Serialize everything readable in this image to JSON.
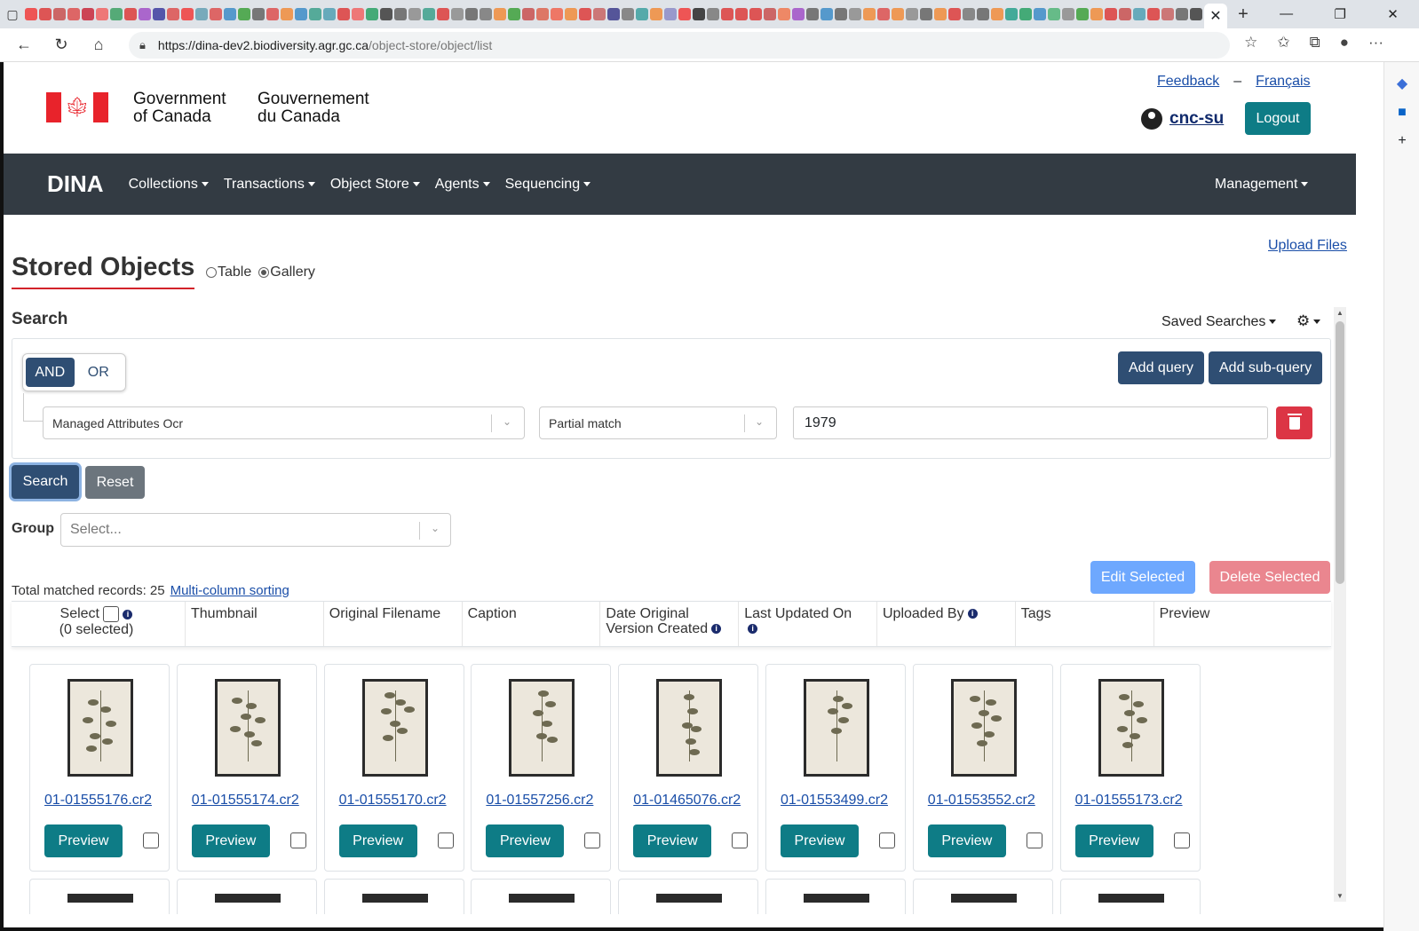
{
  "browser": {
    "url_host": "https://dina-dev2.biodiversity.agr.gc.ca",
    "url_path": "/object-store/object/list",
    "tab_close": "✕",
    "favicon_colors": [
      "#e55",
      "#d55",
      "#c66",
      "#d66",
      "#c45",
      "#e77",
      "#5a7",
      "#d55",
      "#a6c",
      "#55a",
      "#d66",
      "#e55",
      "#7ab",
      "#d66",
      "#59c",
      "#5a5",
      "#777",
      "#d66",
      "#e95",
      "#59c",
      "#5a9",
      "#6ab",
      "#d55",
      "#e77",
      "#4a7",
      "#555",
      "#777",
      "#999",
      "#5a9",
      "#d55",
      "#999",
      "#777",
      "#888",
      "#e95",
      "#5a5",
      "#c66",
      "#d76",
      "#e76",
      "#e95",
      "#d55",
      "#c77",
      "#559",
      "#888",
      "#5aa",
      "#e95",
      "#99c",
      "#e55",
      "#444",
      "#888",
      "#d55",
      "#d55",
      "#d55",
      "#c66",
      "#e86",
      "#a6c",
      "#777",
      "#59c",
      "#777",
      "#999",
      "#e95",
      "#d66",
      "#e95",
      "#999",
      "#777",
      "#e95",
      "#d55",
      "#888",
      "#777",
      "#e95",
      "#4a9",
      "#4a7",
      "#59c",
      "#6b8",
      "#999",
      "#5a5",
      "#e95",
      "#d55",
      "#c66",
      "#6ab",
      "#d55",
      "#c77",
      "#777",
      "#555",
      "#d66",
      "#e86",
      "#999",
      "#999",
      "#d55",
      "#d55",
      "#59c",
      "#d55",
      "#e55",
      "#555",
      "#d55",
      "#d66",
      "#999",
      "#26a",
      "#777",
      "#999",
      "#5a5"
    ]
  },
  "header": {
    "gov_en_line1": "Government",
    "gov_en_line2": "of Canada",
    "gov_fr_line1": "Gouvernement",
    "gov_fr_line2": "du Canada",
    "feedback": "Feedback",
    "separator": "–",
    "language": "Français",
    "username": "cnc-su",
    "logout": "Logout"
  },
  "nav": {
    "brand": "DINA",
    "items": [
      "Collections",
      "Transactions",
      "Object Store",
      "Agents",
      "Sequencing"
    ],
    "right": "Management"
  },
  "page": {
    "upload_files": "Upload Files",
    "title": "Stored Objects",
    "view_table": "Table",
    "view_gallery": "Gallery",
    "selected_view": "Gallery"
  },
  "search": {
    "heading": "Search",
    "saved_searches": "Saved Searches",
    "and_label": "AND",
    "or_label": "OR",
    "add_query": "Add query",
    "add_subquery": "Add sub-query",
    "field": "Managed Attributes Ocr",
    "match_type": "Partial match",
    "value": "1979",
    "search_button": "Search",
    "reset_button": "Reset",
    "group_label": "Group",
    "group_placeholder": "Select..."
  },
  "results": {
    "total_label": "Total matched records: 25",
    "multi_sort": "Multi-column sorting",
    "edit_selected": "Edit Selected",
    "delete_selected": "Delete Selected",
    "columns": {
      "select": "Select",
      "selected_count": "(0 selected)",
      "thumbnail": "Thumbnail",
      "original_filename": "Original Filename",
      "caption": "Caption",
      "date_original": "Date Original Version Created",
      "last_updated": "Last Updated On",
      "uploaded_by": "Uploaded By",
      "tags": "Tags",
      "preview": "Preview"
    },
    "cards": [
      {
        "filename": "01-01555176.cr2",
        "preview": "Preview"
      },
      {
        "filename": "01-01555174.cr2",
        "preview": "Preview"
      },
      {
        "filename": "01-01555170.cr2",
        "preview": "Preview"
      },
      {
        "filename": "01-01557256.cr2",
        "preview": "Preview"
      },
      {
        "filename": "01-01465076.cr2",
        "preview": "Preview"
      },
      {
        "filename": "01-01553499.cr2",
        "preview": "Preview"
      },
      {
        "filename": "01-01553552.cr2",
        "preview": "Preview"
      },
      {
        "filename": "01-01555173.cr2",
        "preview": "Preview"
      }
    ]
  },
  "colors": {
    "navbar": "#333b43",
    "primary": "#2f4e73",
    "teal": "#0e7c86",
    "danger": "#dc3545",
    "link": "#1a4ea8"
  }
}
